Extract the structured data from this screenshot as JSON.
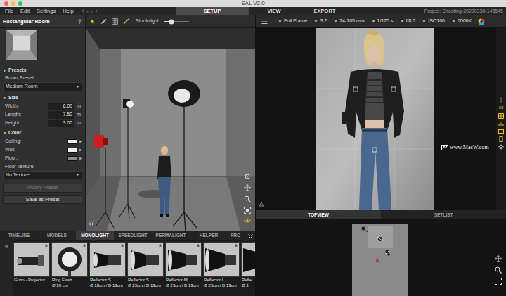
{
  "window": {
    "title": "SAL V2.0"
  },
  "menu": [
    "File",
    "Edit",
    "Settings",
    "Help"
  ],
  "mode_tabs": [
    {
      "label": "SETUP",
      "selected": true
    },
    {
      "label": "VIEW",
      "selected": false
    },
    {
      "label": "EXPORT",
      "selected": false
    }
  ],
  "project": "Project: Shooting-20200330-145545",
  "room_panel": {
    "title": "Rectangular Room",
    "sections": {
      "presets": "Presets",
      "size": "Size",
      "color": "Color"
    },
    "room_preset_label": "Room Preset",
    "room_preset": "Medium Room",
    "size": [
      {
        "label": "Width:",
        "value": "6.00",
        "unit": "m"
      },
      {
        "label": "Length:",
        "value": "7.50",
        "unit": "m"
      },
      {
        "label": "Height:",
        "value": "3.00",
        "unit": "m"
      }
    ],
    "colors": [
      {
        "label": "Ceiling:",
        "color": "#f0f0f0"
      },
      {
        "label": "Wall:",
        "color": "#f0f0f0"
      },
      {
        "label": "Floor:",
        "color": "#8e8e8e"
      }
    ],
    "floor_texture_label": "Floor Texture",
    "floor_texture": "No Texture",
    "buttons": [
      {
        "label": "Modify Preset",
        "disabled": true
      },
      {
        "label": "Save as Preset",
        "disabled": false
      }
    ]
  },
  "studiolight": {
    "label": "Studiolight",
    "level": 0.3
  },
  "camera_settings": [
    "Full Frame",
    "3:2",
    "24-105 mm",
    "1/125 s",
    "f/8.0",
    "ISO100",
    "6000K"
  ],
  "side_indicator": "63",
  "watermark": "www.MacW.com",
  "library_tabs": [
    {
      "label": "TIMELINE",
      "selected": false
    },
    {
      "label": "MODELS",
      "selected": false
    },
    {
      "label": "MONOLIGHT",
      "selected": true
    },
    {
      "label": "SPEEDLIGHT",
      "selected": false
    },
    {
      "label": "PERMALIGHT",
      "selected": false
    },
    {
      "label": "HELPER",
      "selected": false
    },
    {
      "label": "PRO",
      "selected": false
    }
  ],
  "library_items": [
    {
      "lines": [
        "Gobo - Projector"
      ]
    },
    {
      "lines": [
        "Ring Flash",
        "Ø 30 cm"
      ]
    },
    {
      "lines": [
        "Reflector S",
        "Ø 18cm / D 13cm"
      ]
    },
    {
      "lines": [
        "Reflector S",
        "Ø 23cm / D 13cm"
      ]
    },
    {
      "lines": [
        "Reflector M",
        "Ø 23cm / D 13cm"
      ]
    },
    {
      "lines": [
        "Reflector L",
        "Ø 23cm / D 13cm"
      ]
    },
    {
      "lines": [
        "Refle",
        "Ø 3"
      ]
    }
  ],
  "view_tabs": [
    {
      "label": "TOPVIEW",
      "selected": true
    },
    {
      "label": "SETLIST",
      "selected": false
    }
  ]
}
